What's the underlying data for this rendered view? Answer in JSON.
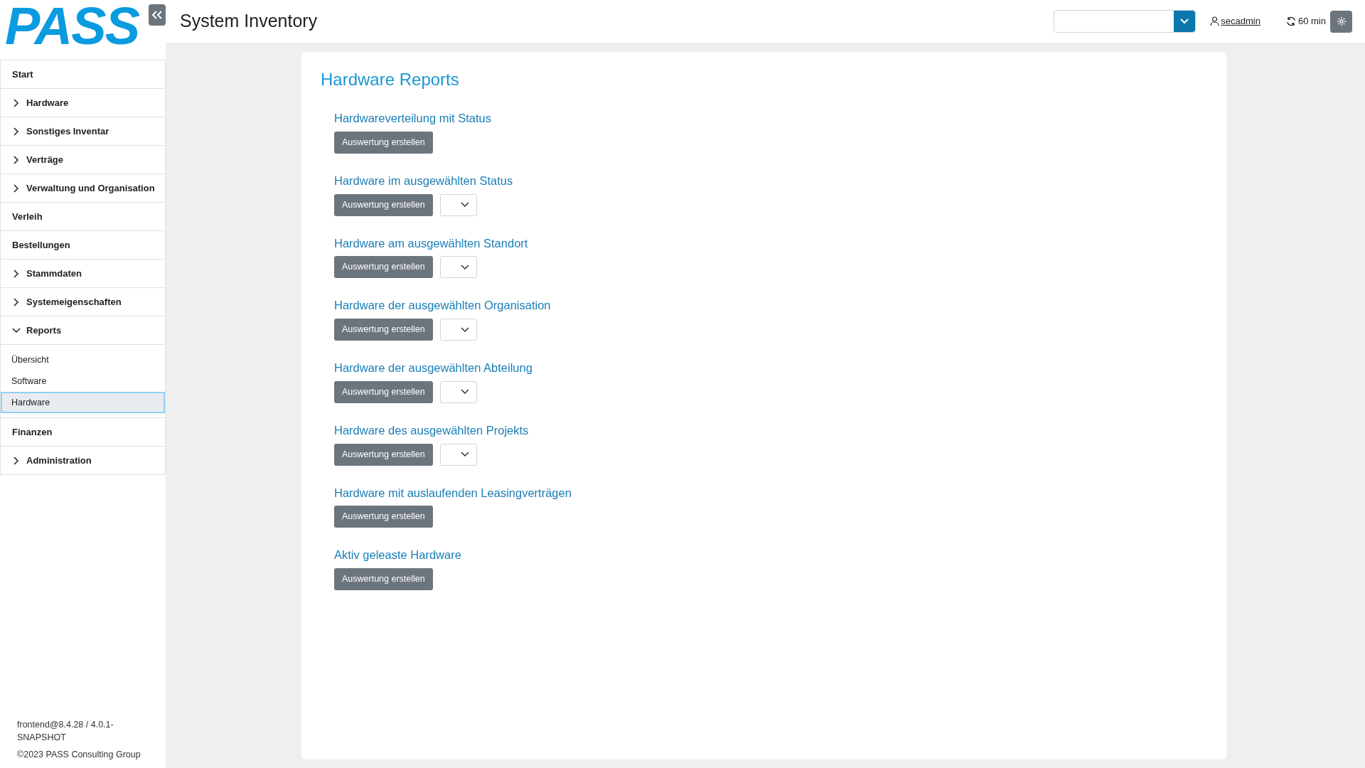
{
  "logo": "PASS",
  "app_title": "System Inventory",
  "header": {
    "user": "secadmin",
    "session": "60 min"
  },
  "sidebar": {
    "items": [
      {
        "label": "Start",
        "kind": "link"
      },
      {
        "label": "Hardware",
        "kind": "group",
        "expanded": false
      },
      {
        "label": "Sonstiges Inventar",
        "kind": "group",
        "expanded": false
      },
      {
        "label": "Verträge",
        "kind": "group",
        "expanded": false
      },
      {
        "label": "Verwaltung und Organisation",
        "kind": "group",
        "expanded": false
      },
      {
        "label": "Verleih",
        "kind": "link"
      },
      {
        "label": "Bestellungen",
        "kind": "link"
      },
      {
        "label": "Stammdaten",
        "kind": "group",
        "expanded": false
      },
      {
        "label": "Systemeigenschaften",
        "kind": "group",
        "expanded": false
      },
      {
        "label": "Reports",
        "kind": "group",
        "expanded": true,
        "children": [
          {
            "label": "Übersicht",
            "selected": false
          },
          {
            "label": "Software",
            "selected": false
          },
          {
            "label": "Hardware",
            "selected": true
          }
        ]
      },
      {
        "label": "Finanzen",
        "kind": "link"
      },
      {
        "label": "Administration",
        "kind": "group",
        "expanded": false
      }
    ],
    "version": "frontend@8.4.28 / 4.0.1-SNAPSHOT",
    "copyright": "©2023 PASS Consulting Group"
  },
  "page": {
    "title": "Hardware Reports",
    "reports": [
      {
        "title": "Hardwareverteilung mit Status",
        "button": "Auswertung erstellen",
        "kind": "plain"
      },
      {
        "title": "Hardware im ausgewählten Status",
        "button": "Auswertung erstellen",
        "kind": "with-select"
      },
      {
        "title": "Hardware am ausgewählten Standort",
        "button": "Auswertung erstellen",
        "kind": "with-select"
      },
      {
        "title": "Hardware der ausgewählten Organisation",
        "button": "Auswertung erstellen",
        "kind": "with-select"
      },
      {
        "title": "Hardware der ausgewählten Abteilung",
        "button": "Auswertung erstellen",
        "kind": "with-select"
      },
      {
        "title": "Hardware des ausgewählten Projekts",
        "button": "Auswertung erstellen",
        "kind": "with-select"
      },
      {
        "title": "Hardware mit auslaufenden Leasingverträgen",
        "button": "Auswertung erstellen",
        "kind": "plain"
      },
      {
        "title": "Aktiv geleaste Hardware",
        "button": "Auswertung erstellen",
        "kind": "plain"
      }
    ]
  }
}
